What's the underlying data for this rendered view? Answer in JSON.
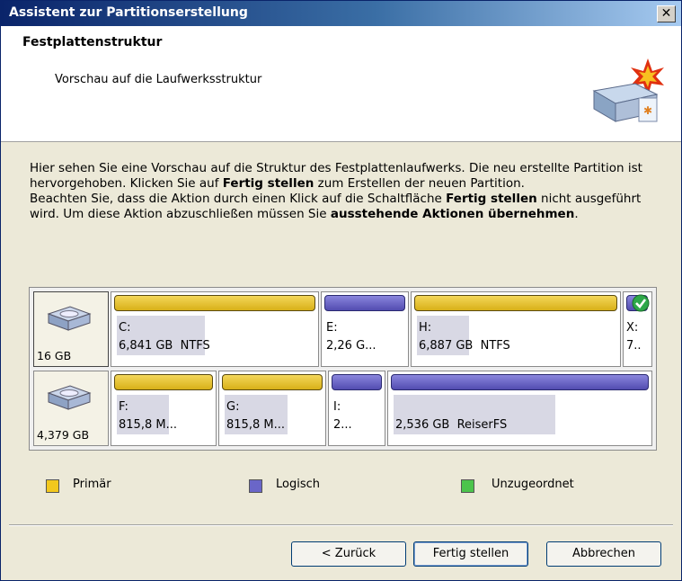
{
  "window": {
    "title": "Assistent zur Partitionserstellung",
    "close_glyph": "✕"
  },
  "header": {
    "title": "Festplattenstruktur",
    "subtitle": "Vorschau auf die Laufwerksstruktur"
  },
  "description": {
    "p1_pre": "Hier sehen Sie eine Vorschau auf die Struktur des Festplattenlaufwerks. Die neu erstellte Partition ist hervorgehoben. Klicken Sie auf ",
    "p1_bold": "Fertig stellen",
    "p1_post": " zum Erstellen der neuen Partition.",
    "p2_pre": "Beachten Sie, dass die Aktion durch einen Klick auf die Schaltfläche ",
    "p2_bold1": "Fertig stellen",
    "p2_mid": " nicht ausgeführt wird. Um diese Aktion abzuschließen müssen Sie ",
    "p2_bold2": "ausstehende Aktionen übernehmen",
    "p2_post": "."
  },
  "disks": [
    {
      "size": "16 GB",
      "partitions": [
        {
          "label": "C:",
          "info": "6,841 GB  NTFS",
          "type": "primary"
        },
        {
          "label": "E:",
          "info": "2,26 G...",
          "type": "logical"
        },
        {
          "label": "H:",
          "info": "6,887 GB  NTFS",
          "type": "primary"
        },
        {
          "label": "X:",
          "info": "7..",
          "type": "logical",
          "selected": true
        }
      ]
    },
    {
      "size": "4,379 GB",
      "partitions": [
        {
          "label": "F:",
          "info": "815,8 M...",
          "type": "primary"
        },
        {
          "label": "G:",
          "info": "815,8 M...",
          "type": "primary"
        },
        {
          "label": "I:",
          "info": "2...",
          "type": "logical"
        },
        {
          "label": "",
          "info": "2,536 GB  ReiserFS",
          "type": "logical"
        }
      ]
    }
  ],
  "legend": {
    "primary": {
      "label": "Primär",
      "color": "#f2c81e"
    },
    "logical": {
      "label": "Logisch",
      "color": "#6a66c8"
    },
    "unassigned": {
      "label": "Unzugeordnet",
      "color": "#4cc44c"
    }
  },
  "buttons": {
    "back": "< Zurück",
    "finish": "Fertig stellen",
    "cancel": "Abbrechen"
  }
}
